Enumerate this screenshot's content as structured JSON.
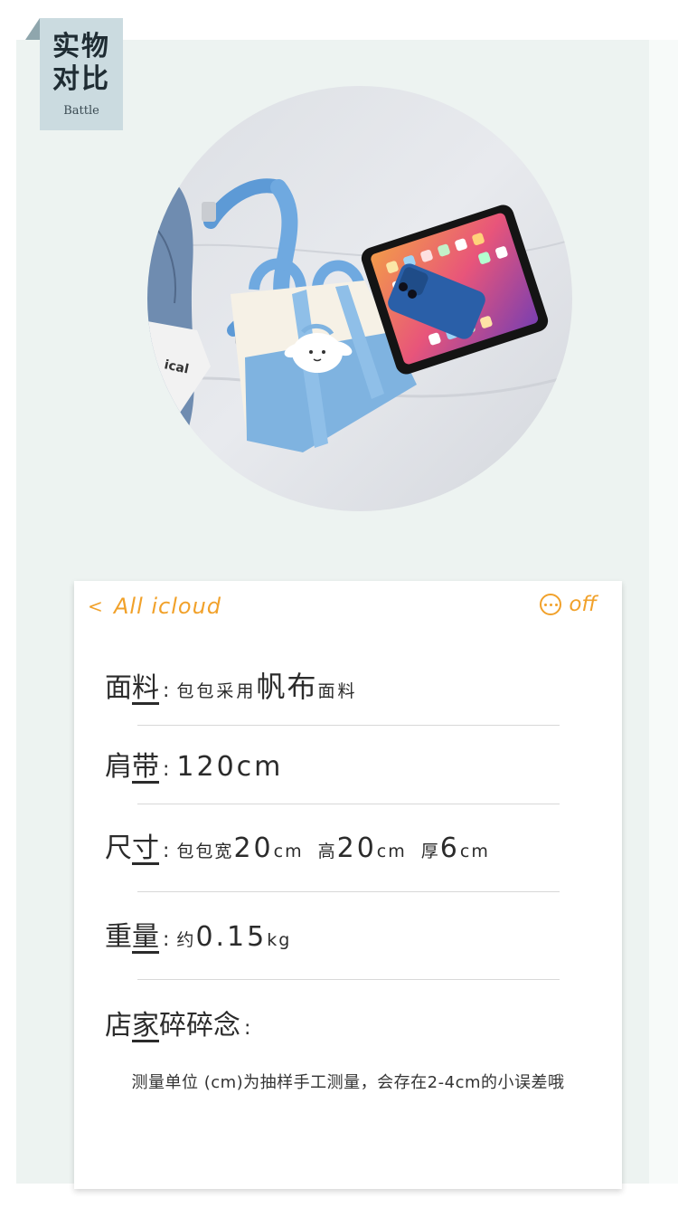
{
  "badge": {
    "title": "实物\n对比",
    "subtitle": "Battle"
  },
  "header": {
    "back": "<",
    "title": "All icloud",
    "action": "off"
  },
  "specs": {
    "fabric": {
      "k1": "面",
      "k2": "料",
      "colon": ":",
      "pre": "包包采用",
      "big": "帆布",
      "post": "面料"
    },
    "strap": {
      "k1": "肩",
      "k2": "带",
      "colon": ":",
      "value": "120cm"
    },
    "size": {
      "k1": "尺",
      "k2": "寸",
      "colon": ":",
      "w_label": "包包宽",
      "w": "20",
      "w_unit": "cm",
      "h_label": "高",
      "h": "20",
      "h_unit": "cm",
      "d_label": "厚",
      "d": "6",
      "d_unit": "cm"
    },
    "weight": {
      "k1": "重",
      "k2": "量",
      "colon": ":",
      "pre": "约",
      "value": "0.15",
      "unit": "kg"
    },
    "notes": {
      "k1": "店",
      "k2": "家",
      "k3": "碎碎念",
      "colon": ":"
    }
  },
  "note": "测量单位 (cm)为抽样手工测量，会存在2-4cm的小误差哦",
  "colors": {
    "accent": "#f1a12a",
    "panel": "#edf3f1",
    "tag": "#cbdbe0",
    "bag_blue": "#7fb3e0"
  }
}
